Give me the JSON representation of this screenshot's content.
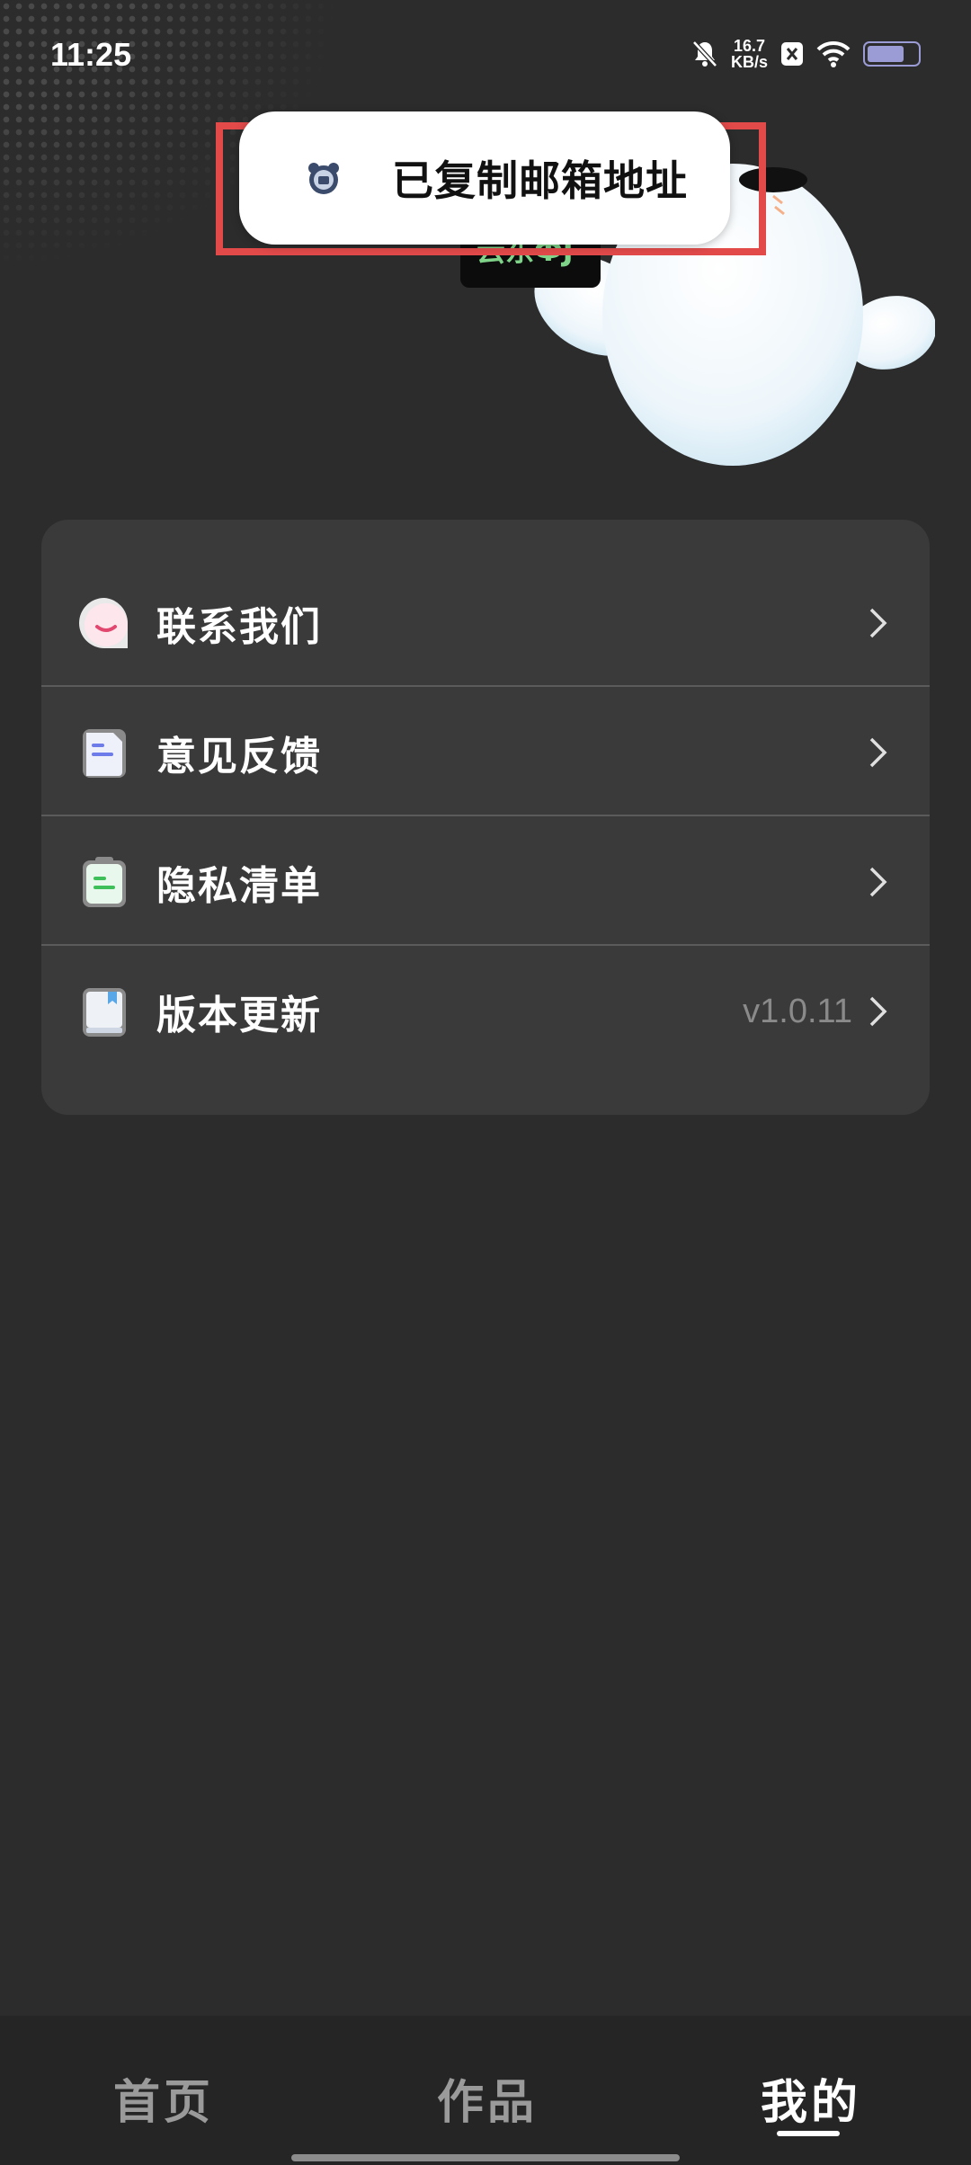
{
  "status_bar": {
    "time": "11:25",
    "net_speed_value": "16.7",
    "net_speed_unit": "KB/s",
    "icons": [
      "bell-off-icon",
      "x-app-icon",
      "wifi-icon",
      "battery-icon"
    ]
  },
  "toast": {
    "logo": "bear-logo-icon",
    "message": "已复制邮箱地址"
  },
  "mascot": {
    "tag_text": "云东ФJ"
  },
  "menu": {
    "items": [
      {
        "label": "联系我们",
        "icon": "chat-bubble-icon",
        "value": ""
      },
      {
        "label": "意见反馈",
        "icon": "document-icon",
        "value": ""
      },
      {
        "label": "隐私清单",
        "icon": "clipboard-icon",
        "value": ""
      },
      {
        "label": "版本更新",
        "icon": "book-icon",
        "value": "v1.0.11"
      }
    ]
  },
  "bottom_nav": {
    "tabs": [
      {
        "label": "首页",
        "active": false
      },
      {
        "label": "作品",
        "active": false
      },
      {
        "label": "我的",
        "active": true
      }
    ]
  },
  "colors": {
    "background": "#2c2c2c",
    "card": "#3a3a3a",
    "highlight": "#e24a4a"
  }
}
